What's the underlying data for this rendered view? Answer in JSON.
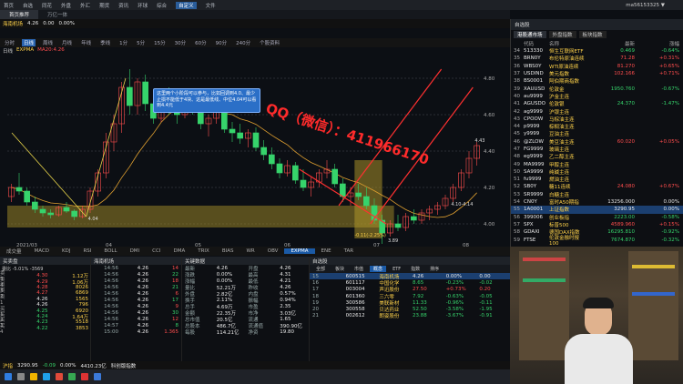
{
  "menubar": {
    "items": [
      "首页",
      "自选",
      "同花",
      "外盘",
      "外汇",
      "期货",
      "资讯",
      "环球",
      "综合",
      "自定义",
      "文件"
    ],
    "active_index": 9,
    "user": "ma56153325 ▼"
  },
  "top_tabs": [
    "首页推荐",
    "万亿一体"
  ],
  "quote": {
    "code": "海南机场",
    "price": "4.26",
    "change": "0.00",
    "pct": "0.00%"
  },
  "periods": [
    "分时",
    "日线",
    "周线",
    "月线",
    "年线",
    "季线",
    "1分",
    "5分",
    "15分",
    "30分",
    "60分",
    "90分",
    "240分",
    "个股资料"
  ],
  "period_active": 1,
  "indicator_line": [
    "日线",
    "EXPMA",
    "MA20:4.26"
  ],
  "chart_data": {
    "type": "candlestick",
    "title": "",
    "x_ticks": [
      "2021/03",
      "04",
      "05",
      "06",
      "07",
      "08"
    ],
    "y_ticks": [
      "4.00",
      "4.20",
      "4.40",
      "4.60",
      "4.80"
    ],
    "ylim": [
      3.9,
      4.9
    ],
    "price_labels": [
      "4.04",
      "4.43",
      "3.89",
      "4.10-4.14"
    ],
    "zone_label": "-0.11(-2.25%)",
    "candles": [
      [
        4.15,
        4.22,
        4.12,
        4.2
      ],
      [
        4.2,
        4.28,
        4.16,
        4.18
      ],
      [
        4.18,
        4.2,
        4.1,
        4.12
      ],
      [
        4.12,
        4.15,
        4.06,
        4.08
      ],
      [
        4.08,
        4.1,
        4.04,
        4.06
      ],
      [
        4.06,
        4.08,
        4.03,
        4.05
      ],
      [
        4.05,
        4.1,
        4.04,
        4.09
      ],
      [
        4.09,
        4.12,
        4.06,
        4.07
      ],
      [
        4.07,
        4.08,
        4.02,
        4.04
      ],
      [
        4.04,
        4.1,
        4.03,
        4.08
      ],
      [
        4.08,
        4.2,
        4.06,
        4.18
      ],
      [
        4.18,
        4.3,
        4.15,
        4.28
      ],
      [
        4.28,
        4.5,
        4.25,
        4.45
      ],
      [
        4.45,
        4.6,
        4.4,
        4.55
      ],
      [
        4.55,
        4.78,
        4.5,
        4.75
      ],
      [
        4.75,
        4.85,
        4.6,
        4.65
      ],
      [
        4.65,
        4.8,
        4.6,
        4.78
      ],
      [
        4.78,
        4.82,
        4.62,
        4.66
      ],
      [
        4.66,
        4.7,
        4.55,
        4.58
      ],
      [
        4.58,
        4.72,
        4.56,
        4.7
      ],
      [
        4.7,
        4.75,
        4.6,
        4.62
      ],
      [
        4.62,
        4.66,
        4.55,
        4.6
      ],
      [
        4.6,
        4.7,
        4.58,
        4.68
      ],
      [
        4.68,
        4.72,
        4.6,
        4.63
      ],
      [
        4.63,
        4.65,
        4.52,
        4.55
      ],
      [
        4.55,
        4.6,
        4.48,
        4.58
      ],
      [
        4.58,
        4.66,
        4.55,
        4.62
      ],
      [
        4.62,
        4.64,
        4.5,
        4.52
      ],
      [
        4.52,
        4.56,
        4.45,
        4.5
      ],
      [
        4.5,
        4.55,
        4.44,
        4.47
      ],
      [
        4.47,
        4.52,
        4.42,
        4.5
      ],
      [
        4.5,
        4.53,
        4.4,
        4.42
      ],
      [
        4.42,
        4.46,
        4.35,
        4.38
      ],
      [
        4.38,
        4.42,
        4.3,
        4.33
      ],
      [
        4.33,
        4.36,
        4.25,
        4.28
      ],
      [
        4.28,
        4.35,
        4.26,
        4.32
      ],
      [
        4.32,
        4.34,
        4.22,
        4.24
      ],
      [
        4.24,
        4.3,
        4.18,
        4.2
      ],
      [
        4.2,
        4.26,
        4.15,
        4.23
      ],
      [
        4.23,
        4.3,
        4.2,
        4.28
      ],
      [
        4.28,
        4.35,
        4.25,
        4.3
      ],
      [
        4.3,
        4.33,
        4.2,
        4.22
      ],
      [
        4.22,
        4.25,
        4.12,
        4.15
      ],
      [
        4.15,
        4.2,
        4.1,
        4.17
      ],
      [
        4.17,
        4.22,
        4.13,
        4.15
      ],
      [
        4.15,
        4.2,
        4.08,
        4.1
      ],
      [
        4.1,
        4.14,
        4.0,
        4.02
      ],
      [
        4.02,
        4.05,
        3.89,
        3.95
      ],
      [
        3.95,
        4.02,
        3.93,
        4.0
      ],
      [
        4.0,
        4.05,
        3.96,
        3.98
      ],
      [
        3.98,
        4.06,
        3.96,
        4.04
      ],
      [
        4.04,
        4.08,
        4.0,
        4.02
      ],
      [
        4.02,
        4.08,
        4.0,
        4.06
      ],
      [
        4.06,
        4.1,
        4.02,
        4.08
      ],
      [
        4.08,
        4.12,
        4.05,
        4.1
      ],
      [
        4.1,
        4.16,
        4.08,
        4.14
      ],
      [
        4.14,
        4.22,
        4.12,
        4.2
      ],
      [
        4.2,
        4.3,
        4.18,
        4.28
      ],
      [
        4.28,
        4.4,
        4.25,
        4.36
      ],
      [
        4.36,
        4.45,
        4.32,
        4.43
      ]
    ]
  },
  "tooltip": "这里两个小阶段可以参与，比如回调到4.0、最少止损不能低于4块、这是最低线、中位4.04可以看到4.4元",
  "watermark": "QQ（微信）：411966170",
  "indicator_tabs": [
    "成交量",
    "MACD",
    "KDJ",
    "RSI",
    "BOLL",
    "DMI",
    "CCI",
    "DMA",
    "TRIX",
    "BIAS",
    "WR",
    "OBV",
    "EXPMA",
    "ENE",
    "TAR"
  ],
  "indicator_active": 12,
  "trade": {
    "title": "买卖盘",
    "info": "委比 -5.01% -3569",
    "rows": [
      {
        "l": "卖5",
        "p": "4.30",
        "v": "1.12万"
      },
      {
        "l": "卖4",
        "p": "4.29",
        "v": "1.06万"
      },
      {
        "l": "卖3",
        "p": "4.28",
        "v": "8026"
      },
      {
        "l": "卖2",
        "p": "4.27",
        "v": "6869"
      },
      {
        "l": "卖1",
        "p": "4.26",
        "v": "1565"
      },
      {
        "l": "",
        "p": "4.26",
        "v": "796"
      },
      {
        "l": "买1",
        "p": "4.25",
        "v": "6920"
      },
      {
        "l": "买2",
        "p": "4.24",
        "v": "1.64万"
      },
      {
        "l": "买3",
        "p": "4.23",
        "v": "5518"
      },
      {
        "l": "买4",
        "p": "4.22",
        "v": "3853"
      }
    ]
  },
  "ticks": {
    "title": "海南机场",
    "rows": [
      {
        "t": "14:56",
        "p": "4.26",
        "v": "14"
      },
      {
        "t": "14:56",
        "p": "4.26",
        "v": "22"
      },
      {
        "t": "14:56",
        "p": "4.26",
        "v": "18"
      },
      {
        "t": "14:56",
        "p": "4.26",
        "v": "21"
      },
      {
        "t": "14:56",
        "p": "4.26",
        "v": "6"
      },
      {
        "t": "14:56",
        "p": "4.26",
        "v": "17"
      },
      {
        "t": "14:56",
        "p": "4.26",
        "v": "9"
      },
      {
        "t": "14:56",
        "p": "4.26",
        "v": "30"
      },
      {
        "t": "14:56",
        "p": "4.26",
        "v": "12"
      },
      {
        "t": "14:57",
        "p": "4.26",
        "v": "8"
      },
      {
        "t": "15:00",
        "p": "4.26",
        "v": "1.365"
      }
    ]
  },
  "keydata": {
    "title": "关键数据",
    "rows": [
      {
        "a": "最新",
        "b": "4.26",
        "c": "开盘",
        "d": "4.26"
      },
      {
        "a": "涨跌",
        "b": "0.00%",
        "c": "最高",
        "d": "4.31"
      },
      {
        "a": "涨幅",
        "b": "0.00%",
        "c": "最低",
        "d": "4.21"
      },
      {
        "a": "量比",
        "b": "52.21万",
        "c": "昨收",
        "d": "4.26"
      },
      {
        "a": "外盘",
        "b": "2.82亿",
        "c": "内盘",
        "d": "0.57%"
      },
      {
        "a": "换手",
        "b": "2.11%",
        "c": "振幅",
        "d": "0.94%"
      },
      {
        "a": "总手",
        "b": "4.69万",
        "c": "市盈",
        "d": "2.35"
      },
      {
        "a": "金额",
        "b": "22.35万",
        "c": "市净",
        "d": "3.03亿"
      },
      {
        "a": "总市值",
        "b": "20.5亿",
        "c": "流通",
        "d": "1.65"
      },
      {
        "a": "总股本",
        "b": "486.7亿",
        "c": "流通值",
        "d": "390.90亿"
      },
      {
        "a": "每股",
        "b": "114.21亿",
        "c": "净资",
        "d": "19.80"
      }
    ]
  },
  "watch": {
    "title": "自选股",
    "buttons": [
      "全部",
      "板块",
      "市值",
      "概念",
      "ETF",
      "指数",
      "排序"
    ],
    "active_button": 3,
    "rows": [
      {
        "n": "15",
        "c": "600515",
        "name": "海南机场",
        "p": "4.26",
        "ch": "0.00%",
        "v": "0.00"
      },
      {
        "n": "16",
        "c": "601117",
        "name": "中国化学",
        "p": "8.65",
        "ch": "-0.23%",
        "v": "-0.02"
      },
      {
        "n": "17",
        "c": "003004",
        "name": "声迅股份",
        "p": "27.50",
        "ch": "+0.73%",
        "v": "0.20"
      },
      {
        "n": "18",
        "c": "601360",
        "name": "三六零",
        "p": "7.92",
        "ch": "-0.63%",
        "v": "-0.05"
      },
      {
        "n": "19",
        "c": "300586",
        "name": "美联新材",
        "p": "11.33",
        "ch": "-0.96%",
        "v": "-0.11"
      },
      {
        "n": "20",
        "c": "300558",
        "name": "贝达药业",
        "p": "52.50",
        "ch": "-3.58%",
        "v": "-1.95"
      },
      {
        "n": "21",
        "c": "002612",
        "name": "朗姿股份",
        "p": "23.88",
        "ch": "-3.67%",
        "v": "-0.91"
      }
    ]
  },
  "statusbar": [
    "沪指",
    "3290.95",
    "-0.09",
    "0.00%",
    "4410.23亿",
    "科创版指数"
  ],
  "rightpanel": {
    "title": "自选股",
    "tabs": [
      "港股通市场",
      "外盘指数",
      "板块指数"
    ],
    "active_tab": 0,
    "cols": [
      "",
      "代码",
      "名称",
      "",
      "最新",
      "涨幅"
    ],
    "rows": [
      {
        "n": "34",
        "c": "513330",
        "name": "恒生互联网ETF",
        "p": "0.469",
        "ch": "-0.64%"
      },
      {
        "n": "35",
        "c": "BRN0Y",
        "name": "布伦特原油连续",
        "p": "71.28",
        "ch": "+0.31%"
      },
      {
        "n": "36",
        "c": "WBS0Y",
        "name": "WTI原油连续",
        "p": "81.270",
        "ch": "+0.65%"
      },
      {
        "n": "37",
        "c": "USDIND",
        "name": "美元指数",
        "p": "102.166",
        "ch": "+0.71%"
      },
      {
        "n": "38",
        "c": "BS0001",
        "name": "阿伯期商指数",
        "p": "",
        "ch": ""
      },
      {
        "n": "39",
        "c": "XAUUSD",
        "name": "伦敦金",
        "p": "1950.760",
        "ch": "-0.67%"
      },
      {
        "n": "40",
        "c": "au9999",
        "name": "沪金主连",
        "p": "",
        "ch": ""
      },
      {
        "n": "41",
        "c": "AGUSDO",
        "name": "伦敦银",
        "p": "24.370",
        "ch": "-1.47%"
      },
      {
        "n": "42",
        "c": "ag9999",
        "name": "沪银主连",
        "p": "",
        "ch": ""
      },
      {
        "n": "43",
        "c": "CPOOW",
        "name": "马棕油主连",
        "p": "",
        "ch": ""
      },
      {
        "n": "44",
        "c": "p9999",
        "name": "棕榈油主连",
        "p": "",
        "ch": ""
      },
      {
        "n": "45",
        "c": "y9999",
        "name": "豆油主连",
        "p": "",
        "ch": ""
      },
      {
        "n": "46",
        "c": "@ZLOW",
        "name": "美豆油主连",
        "p": "60.020",
        "ch": "+0.05%"
      },
      {
        "n": "47",
        "c": "FG9999",
        "name": "玻璃主连",
        "p": "",
        "ch": ""
      },
      {
        "n": "48",
        "c": "eg9999",
        "name": "乙二醇主连",
        "p": "",
        "ch": ""
      },
      {
        "n": "49",
        "c": "MA9999",
        "name": "甲醇主连",
        "p": "",
        "ch": ""
      },
      {
        "n": "50",
        "c": "SA9999",
        "name": "纯碱主连",
        "p": "",
        "ch": ""
      },
      {
        "n": "51",
        "c": "fu9999",
        "name": "燃油主连",
        "p": "",
        "ch": ""
      },
      {
        "n": "52",
        "c": "SB0Y",
        "name": "糖11连续",
        "p": "24.080",
        "ch": "+0.67%"
      },
      {
        "n": "53",
        "c": "SR9999",
        "name": "白糖主连",
        "p": "",
        "ch": ""
      },
      {
        "n": "54",
        "c": "CN0Y",
        "name": "富时A50期指",
        "p": "13256.000",
        "ch": "0.00%"
      },
      {
        "n": "55",
        "c": "1A0001",
        "name": "上证指数",
        "p": "3290.95",
        "ch": "0.00%"
      },
      {
        "n": "56",
        "c": "399006",
        "name": "创业板指",
        "p": "2223.00",
        "ch": "-0.58%"
      },
      {
        "n": "57",
        "c": "SPX",
        "name": "标普500",
        "p": "4589.960",
        "ch": "+0.15%"
      },
      {
        "n": "58",
        "c": "GDAXI",
        "name": "德国DAX指数",
        "p": "16295.810",
        "ch": "-0.92%"
      },
      {
        "n": "59",
        "c": "FTSE",
        "name": "伦敦金融时报100",
        "p": "7674.870",
        "ch": "-0.32%"
      }
    ],
    "selected_row": 21
  },
  "colors": {
    "up": "#ff4d4d",
    "down": "#36d36b",
    "accent": "#1b5aa6",
    "support_zone": "#b59b2a"
  }
}
